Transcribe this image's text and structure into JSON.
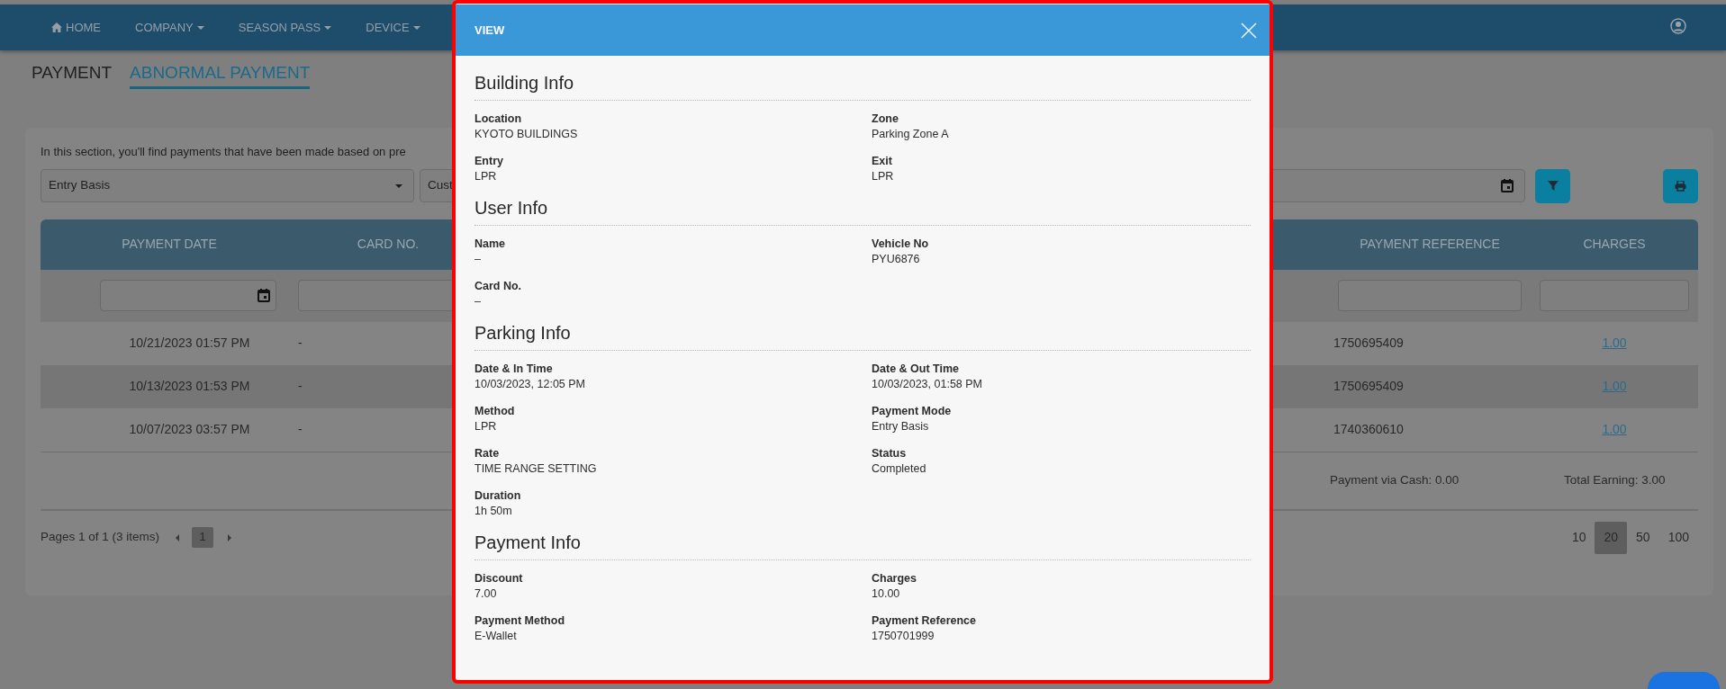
{
  "navbar": {
    "items": [
      {
        "label": "HOME",
        "dropdown": false
      },
      {
        "label": "COMPANY",
        "dropdown": true
      },
      {
        "label": "SEASON PASS",
        "dropdown": true
      },
      {
        "label": "DEVICE",
        "dropdown": true
      }
    ]
  },
  "page_tabs": [
    {
      "label": "PAYMENT",
      "selected": false
    },
    {
      "label": "ABNORMAL PAYMENT",
      "selected": true
    }
  ],
  "description": "In this section, you'll find payments that have been made based on pre",
  "dropdowns": [
    "Entry Basis",
    "Cust"
  ],
  "table": {
    "columns": [
      "PAYMENT DATE",
      "CARD NO.",
      "PAYMENT REFERENCE",
      "CHARGES"
    ],
    "rows": [
      {
        "payment_date": "10/21/2023 01:57 PM",
        "card_no": "-",
        "payment_reference": "1750695409",
        "charges": "1.00"
      },
      {
        "payment_date": "10/13/2023 01:53 PM",
        "card_no": "-",
        "payment_reference": "1750695409",
        "charges": "1.00"
      },
      {
        "payment_date": "10/07/2023 03:57 PM",
        "card_no": "-",
        "payment_reference": "1740360610",
        "charges": "1.00"
      }
    ],
    "summary": [
      "Payment via Cash: 0.00",
      "Total Earning: 3.00"
    ]
  },
  "pager": {
    "info": "Pages 1 of 1 (3 items)",
    "pages": [
      {
        "label": "1",
        "selected": true
      }
    ],
    "page_sizes": [
      {
        "label": "10",
        "selected": false
      },
      {
        "label": "20",
        "selected": true
      },
      {
        "label": "50",
        "selected": false
      },
      {
        "label": "100",
        "selected": false
      }
    ]
  },
  "modal": {
    "title": "VIEW",
    "sections": [
      {
        "title": "Building Info",
        "fields": [
          {
            "label": "Location",
            "value": "KYOTO BUILDINGS"
          },
          {
            "label": "Zone",
            "value": "Parking Zone A"
          },
          {
            "label": "Entry",
            "value": "LPR"
          },
          {
            "label": "Exit",
            "value": "LPR"
          }
        ]
      },
      {
        "title": "User Info",
        "fields": [
          {
            "label": "Name",
            "value": "–"
          },
          {
            "label": "Vehicle No",
            "value": "PYU6876"
          },
          {
            "label": "Card No.",
            "value": "–"
          }
        ]
      },
      {
        "title": "Parking Info",
        "fields": [
          {
            "label": "Date & In Time",
            "value": "10/03/2023, 12:05 PM"
          },
          {
            "label": "Date & Out Time",
            "value": "10/03/2023, 01:58 PM"
          },
          {
            "label": "Method",
            "value": "LPR"
          },
          {
            "label": "Payment Mode",
            "value": "Entry Basis"
          },
          {
            "label": "Rate",
            "value": "TIME RANGE SETTING"
          },
          {
            "label": "Status",
            "value": "Completed"
          },
          {
            "label": "Duration",
            "value": "1h 50m"
          }
        ]
      },
      {
        "title": "Payment Info",
        "fields": [
          {
            "label": "Discount",
            "value": "7.00"
          },
          {
            "label": "Charges",
            "value": "10.00"
          },
          {
            "label": "Payment Method",
            "value": "E-Wallet"
          },
          {
            "label": "Payment Reference",
            "value": "1750701999"
          }
        ]
      }
    ]
  }
}
